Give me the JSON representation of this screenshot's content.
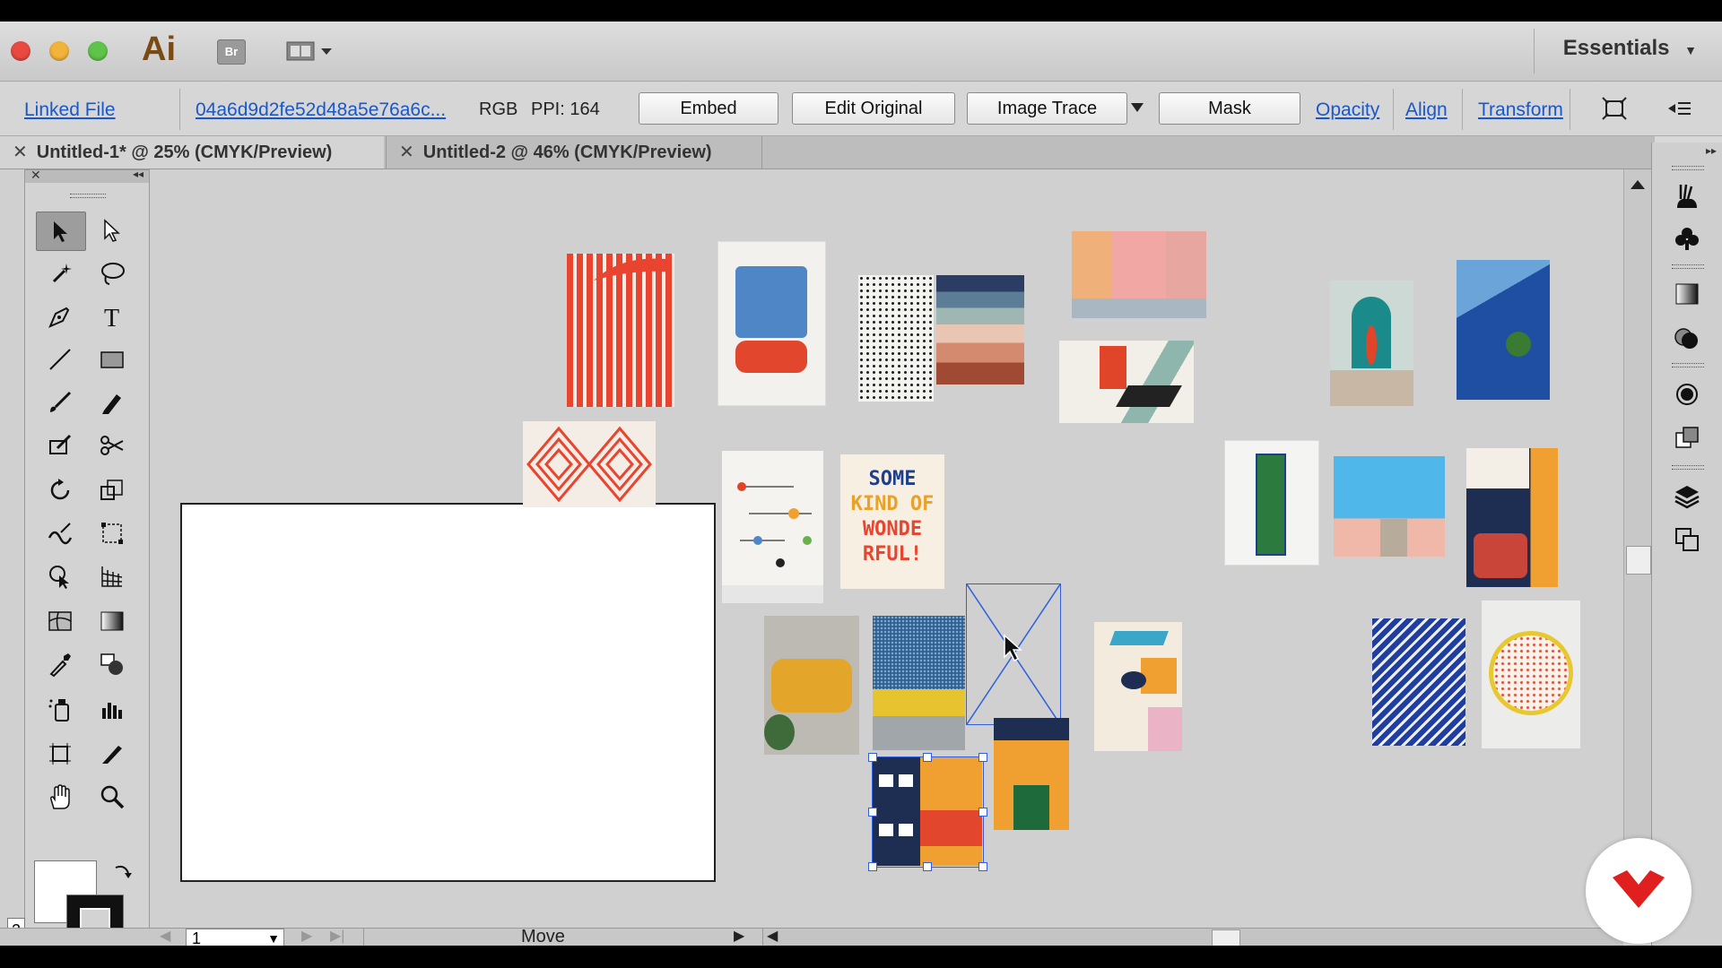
{
  "titlebar": {
    "app_logo": "Ai",
    "bridge_label": "Br",
    "workspace": "Essentials"
  },
  "control_bar": {
    "linked_file": "Linked File",
    "file_name": "04a6d9d2fe52d48a5e76a6c...",
    "color_mode": "RGB",
    "ppi": "PPI: 164",
    "embed": "Embed",
    "edit_original": "Edit Original",
    "image_trace": "Image Trace",
    "mask": "Mask",
    "opacity": "Opacity",
    "align": "Align",
    "transform": "Transform"
  },
  "tabs": [
    {
      "label": "Untitled-1* @ 25% (CMYK/Preview)",
      "active": true
    },
    {
      "label": "Untitled-2 @ 46% (CMYK/Preview)",
      "active": false
    }
  ],
  "canvas": {
    "artwork_text": [
      "SOME",
      "KIND OF",
      "WONDE",
      "RFUL!"
    ]
  },
  "statusbar": {
    "page": "1",
    "mode": "Move",
    "left_num": "2"
  },
  "colors": {
    "link": "#1a57c9",
    "selection": "#2f5fdc",
    "canvas": "#d0d0d0"
  },
  "icons": {
    "tools": [
      "selection",
      "direct-selection",
      "magic-wand",
      "lasso",
      "pen",
      "type",
      "line",
      "rectangle",
      "paintbrush",
      "pencil",
      "blob-brush",
      "scissors",
      "rotate",
      "scale",
      "warp",
      "free-transform",
      "shape-builder",
      "perspective-grid",
      "mesh",
      "gradient",
      "eyedropper",
      "blend",
      "symbol-sprayer",
      "column-graph",
      "artboard",
      "slice",
      "hand",
      "zoom"
    ],
    "dock": [
      "brushes",
      "symbols",
      "gradient",
      "transparency",
      "appearance",
      "graphic-styles",
      "layers",
      "artboards"
    ]
  }
}
